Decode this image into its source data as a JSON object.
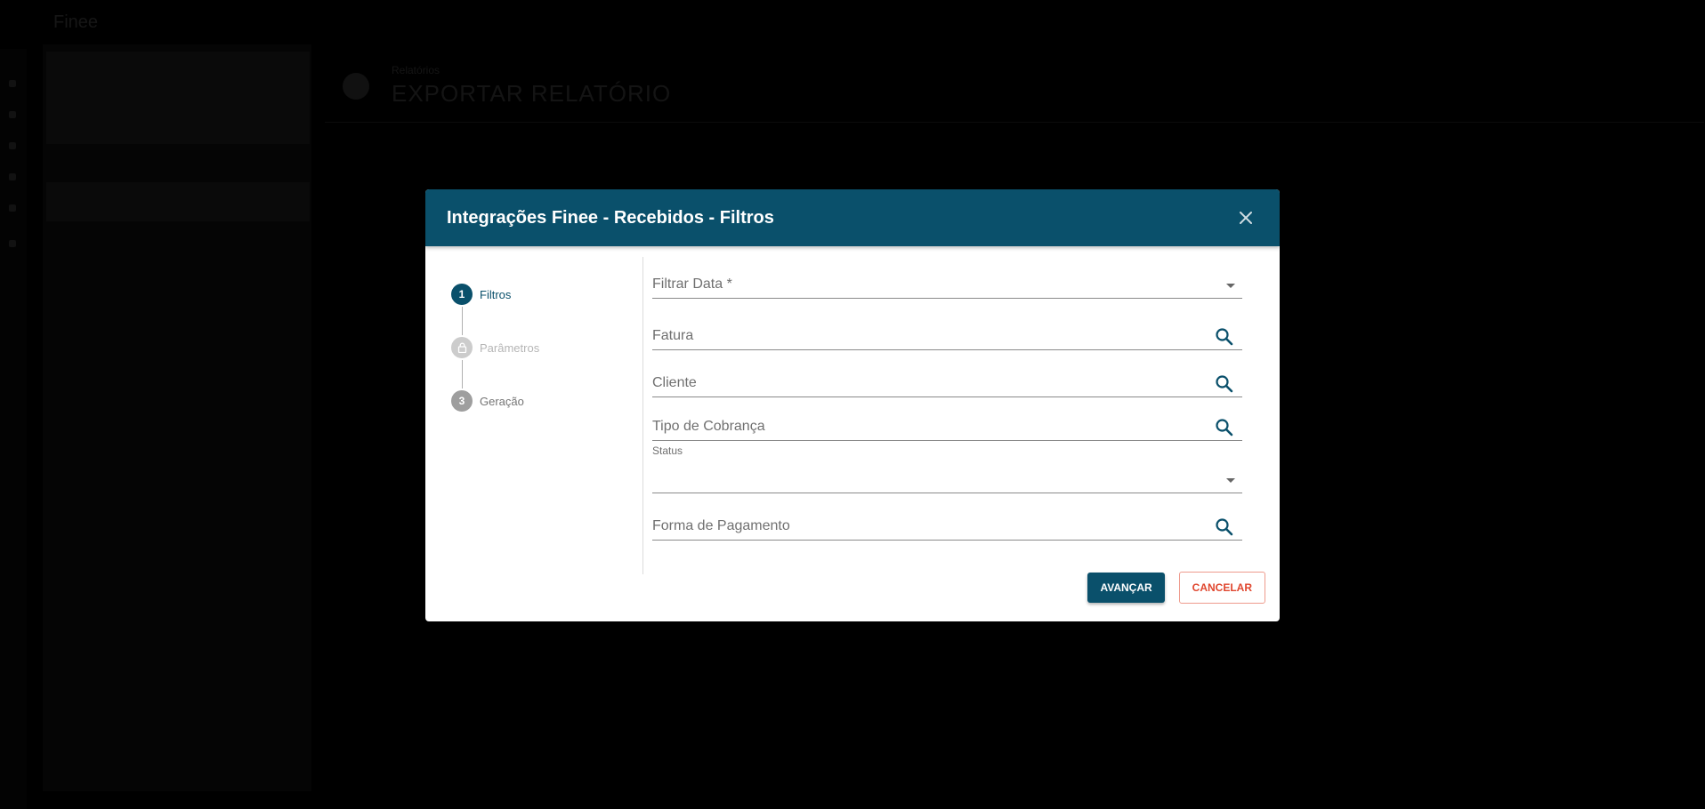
{
  "background": {
    "topbar_text": "Finee",
    "header_small": "Relatórios",
    "header_title": "EXPORTAR RELATÓRIO"
  },
  "dialog": {
    "title": "Integrações Finee - Recebidos - Filtros",
    "steps": [
      {
        "number": "1",
        "label": "Filtros",
        "state": "active"
      },
      {
        "number": "",
        "label": "Parâmetros",
        "state": "locked"
      },
      {
        "number": "3",
        "label": "Geração",
        "state": "pending"
      }
    ],
    "fields": {
      "filtrar_data": "Filtrar Data *",
      "fatura": "Fatura",
      "cliente": "Cliente",
      "tipo_cobranca": "Tipo de Cobrança",
      "status": "Status",
      "forma_pagamento": "Forma de Pagamento"
    },
    "buttons": {
      "advance": "AVANÇAR",
      "cancel": "CANCELAR"
    }
  },
  "colors": {
    "primary": "#0a506b",
    "danger": "#e0472f",
    "step_pending": "#9e9e9e",
    "step_locked": "#cccccc"
  },
  "icons": {
    "close": "close-icon",
    "search": "search-icon",
    "lock": "lock-icon",
    "dropdown": "chevron-down-icon"
  }
}
